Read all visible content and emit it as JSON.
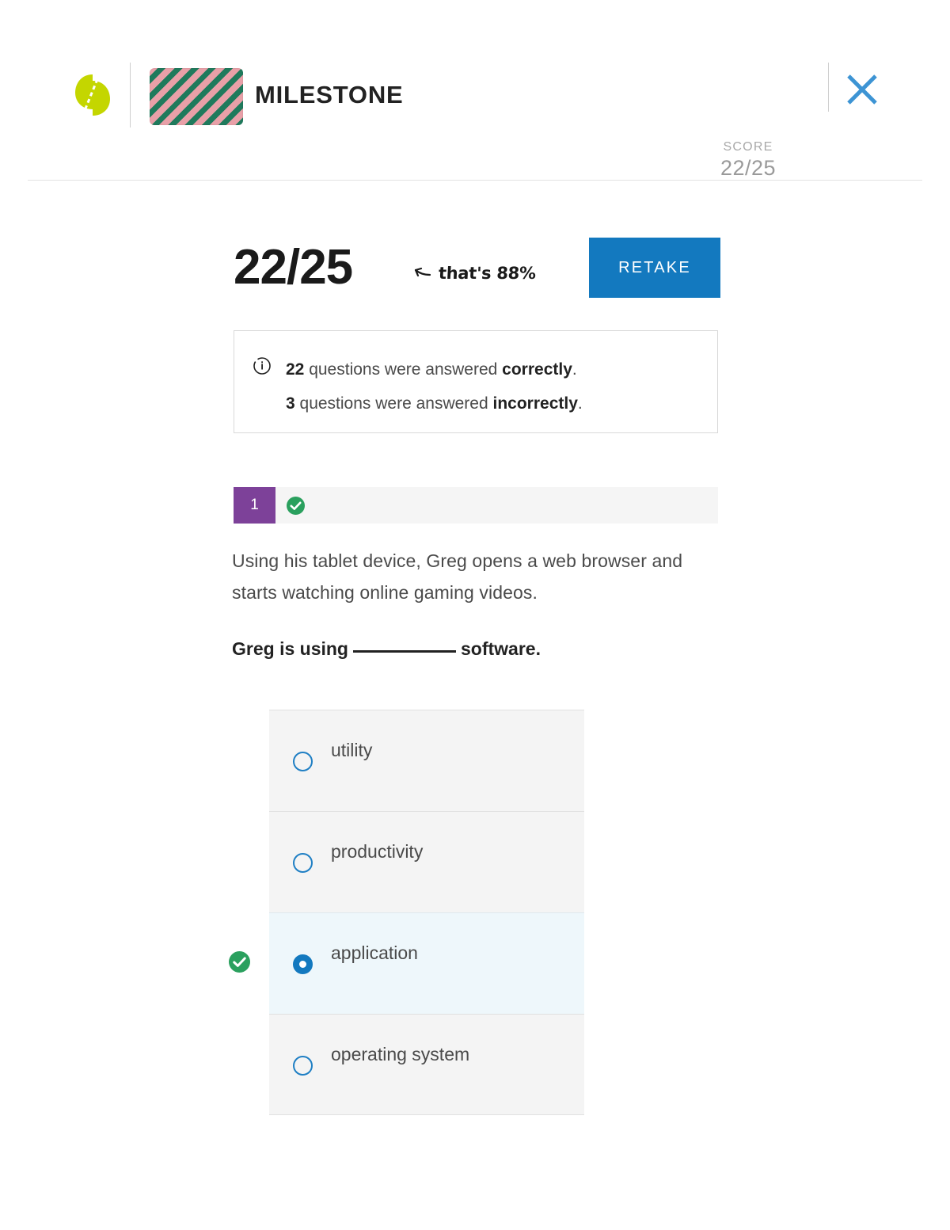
{
  "header": {
    "logo_icon": "sophia-leaf-logo-icon",
    "course_thumb_icon": "course-thumbnail-pattern",
    "title": "MILESTONE",
    "close_icon": "close-icon",
    "score_label": "SCORE",
    "score_value": "22/25"
  },
  "summary": {
    "big_score": "22/25",
    "note_arrow_icon": "curved-arrow-icon",
    "note_text": "that's 88%",
    "retake_label": "RETAKE",
    "info_icon": "info-circle-icon",
    "line1_count": "22",
    "line1_mid": " questions were answered ",
    "line1_emphasis": "correctly",
    "line1_end": ".",
    "line2_count": "3",
    "line2_mid": " questions were answered ",
    "line2_emphasis": "incorrectly",
    "line2_end": "."
  },
  "question": {
    "number": "1",
    "status_icon": "check-circle-icon",
    "status": "correct",
    "stem": "Using his tablet device, Greg opens a web browser and starts watching online gaming videos.",
    "prompt_before": "Greg is using",
    "prompt_after": "software.",
    "correct_icon": "check-circle-icon",
    "options": [
      {
        "label": "utility",
        "selected": false,
        "correct": false
      },
      {
        "label": "productivity",
        "selected": false,
        "correct": false
      },
      {
        "label": "application",
        "selected": true,
        "correct": true
      },
      {
        "label": "operating system",
        "selected": false,
        "correct": false
      }
    ]
  },
  "colors": {
    "accent_blue": "#1379bf",
    "purple_badge": "#7d4199",
    "green_correct": "#2aa05e",
    "logo_green": "#c4d600",
    "thumb_pink": "#e8a0a8",
    "thumb_green": "#1f7a5c",
    "option_bg": "#f4f4f4",
    "option_selected_bg": "#eef7fb"
  }
}
